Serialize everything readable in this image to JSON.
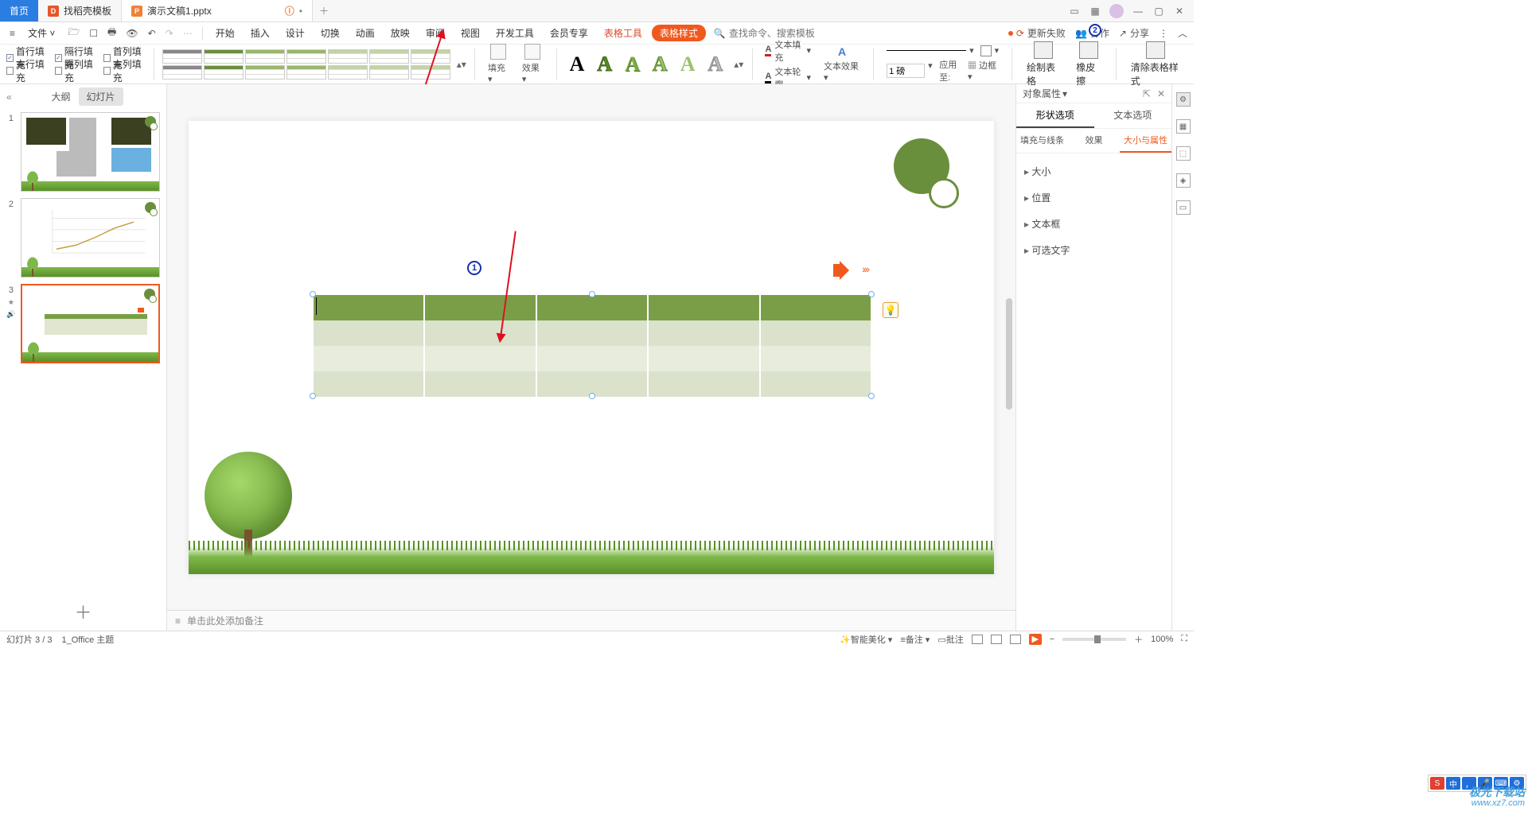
{
  "tabs": {
    "home": "首页",
    "template": "找稻壳模板",
    "doc": "演示文稿1.pptx"
  },
  "menu": {
    "file": "文件",
    "items": [
      "开始",
      "插入",
      "设计",
      "切换",
      "动画",
      "放映",
      "审阅",
      "视图",
      "开发工具",
      "会员专享"
    ],
    "table_tool": "表格工具",
    "table_style": "表格样式",
    "search_ph": "查找命令、搜索模板",
    "update_fail": "更新失败",
    "coop": "协作",
    "share": "分享"
  },
  "ribbon": {
    "checks": {
      "r1c1": "首行填充",
      "r1c2": "隔行填充",
      "r1c3": "首列填充",
      "r2c1": "末行填充",
      "r2c2": "隔列填充",
      "r2c3": "末列填充"
    },
    "fill": "填充",
    "effect": "效果",
    "text_fill": "文本填充",
    "text_outline": "文本轮廓",
    "text_effect": "文本效果",
    "pt_val": "1 磅",
    "apply": "应用至:",
    "border": "边框",
    "draw_table": "绘制表格",
    "eraser": "橡皮擦",
    "clear": "清除表格样式"
  },
  "left": {
    "outline": "大纲",
    "slides": "幻灯片"
  },
  "prop": {
    "title": "对象属性",
    "tab_shape": "形状选项",
    "tab_text": "文本选项",
    "sub_fill": "填充与线条",
    "sub_effect": "效果",
    "sub_size": "大小与属性",
    "sec_size": "大小",
    "sec_pos": "位置",
    "sec_textbox": "文本框",
    "sec_alt": "可选文字"
  },
  "notes_ph": "单击此处添加备注",
  "status": {
    "slide": "幻灯片 3 / 3",
    "theme": "1_Office 主题",
    "beautify": "智能美化",
    "backup": "备注",
    "comment": "批注",
    "zoom": "100%"
  },
  "wm": {
    "brand": "极光下载站",
    "url": "www.xz7.com"
  }
}
